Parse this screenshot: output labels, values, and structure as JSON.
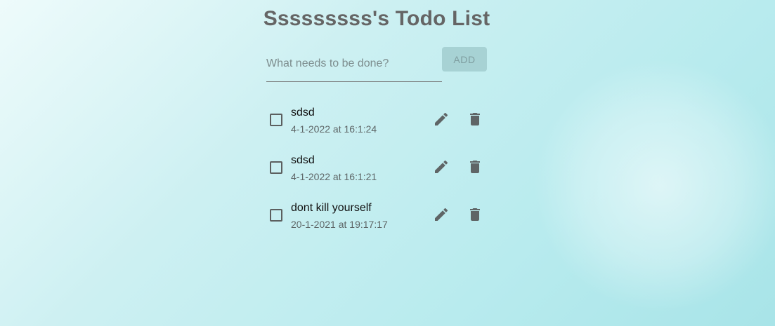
{
  "header": {
    "title": "Sssssssss's Todo List"
  },
  "form": {
    "input_value": "",
    "input_placeholder": "What needs to be done?",
    "add_label": "ADD"
  },
  "todos": [
    {
      "text": "sdsd",
      "date": "4-1-2022 at 16:1:24",
      "checked": false
    },
    {
      "text": "sdsd",
      "date": "4-1-2022 at 16:1:21",
      "checked": false
    },
    {
      "text": "dont kill yourself",
      "date": "20-1-2021 at 19:17:17",
      "checked": false
    }
  ],
  "icons": {
    "edit": "pencil-icon",
    "delete": "trash-icon"
  },
  "colors": {
    "title": "#656565",
    "add_button_bg": "#a7d2d4",
    "icon": "#5f6566"
  }
}
